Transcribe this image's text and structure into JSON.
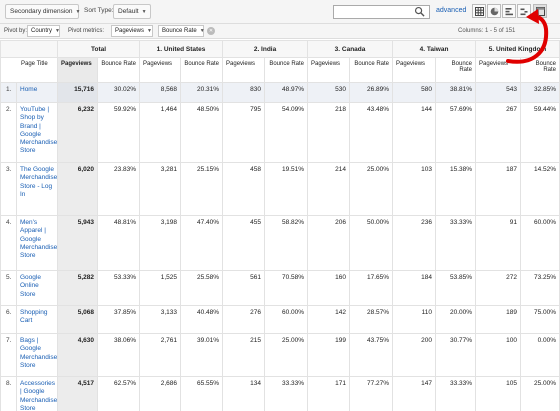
{
  "toolbar": {
    "secondary_dimension": "Secondary dimension",
    "sort_type_label": "Sort Type:",
    "sort_type_value": "Default",
    "search_value": "",
    "advanced": "advanced"
  },
  "pivot": {
    "pivot_by_label": "Pivot by:",
    "pivot_by_value": "Country",
    "pivot_metrics_label": "Pivot metrics:",
    "metric1": "Pageviews",
    "metric2": "Bounce Rate",
    "columns_text": "Columns:  1 - 5 of 151"
  },
  "table": {
    "groups": [
      "Total",
      "1. United States",
      "2. India",
      "3. Canada",
      "4. Taiwan",
      "5. United Kingdom"
    ],
    "sub": {
      "page_title": "Page Title",
      "pageviews": "Pageviews",
      "bounce": "Bounce Rate"
    },
    "rows": [
      {
        "idx": "1.",
        "title": "Home",
        "total": "15,716",
        "cells": [
          "30.02%",
          "8,568",
          "20.31%",
          "830",
          "48.97%",
          "530",
          "26.89%",
          "580",
          "38.81%",
          "543",
          "32.85%"
        ]
      },
      {
        "idx": "2.",
        "title": "YouTube | Shop by Brand | Google Merchandise Store",
        "total": "6,232",
        "cells": [
          "59.92%",
          "1,464",
          "48.50%",
          "795",
          "54.09%",
          "218",
          "43.48%",
          "144",
          "57.69%",
          "267",
          "59.44%"
        ]
      },
      {
        "idx": "3.",
        "title": "The Google Merchandise Store - Log In",
        "total": "6,020",
        "cells": [
          "23.83%",
          "3,281",
          "25.15%",
          "458",
          "19.51%",
          "214",
          "25.00%",
          "103",
          "15.38%",
          "187",
          "14.52%"
        ]
      },
      {
        "idx": "4.",
        "title": "Men's Apparel | Google Merchandise Store",
        "total": "5,943",
        "cells": [
          "48.81%",
          "3,198",
          "47.40%",
          "455",
          "58.82%",
          "206",
          "50.00%",
          "236",
          "33.33%",
          "91",
          "60.00%"
        ]
      },
      {
        "idx": "5.",
        "title": "Google Online Store",
        "total": "5,282",
        "cells": [
          "53.33%",
          "1,525",
          "25.58%",
          "561",
          "70.58%",
          "160",
          "17.65%",
          "184",
          "53.85%",
          "272",
          "73.25%"
        ]
      },
      {
        "idx": "6.",
        "title": "Shopping Cart",
        "total": "5,068",
        "cells": [
          "37.85%",
          "3,133",
          "40.48%",
          "276",
          "60.00%",
          "142",
          "28.57%",
          "110",
          "20.00%",
          "189",
          "75.00%"
        ]
      },
      {
        "idx": "7.",
        "title": "Bags | Google Merchandise Store",
        "total": "4,630",
        "cells": [
          "38.06%",
          "2,761",
          "39.01%",
          "215",
          "25.00%",
          "199",
          "43.75%",
          "200",
          "30.77%",
          "100",
          "0.00%"
        ]
      },
      {
        "idx": "8.",
        "title": "Accessories | Google Merchandise Store",
        "total": "4,517",
        "cells": [
          "62.57%",
          "2,686",
          "65.55%",
          "134",
          "33.33%",
          "171",
          "77.27%",
          "147",
          "33.33%",
          "105",
          "25.00%"
        ]
      }
    ]
  },
  "colors": {
    "link": "#1a5fb4",
    "arrow": "#e00000"
  }
}
